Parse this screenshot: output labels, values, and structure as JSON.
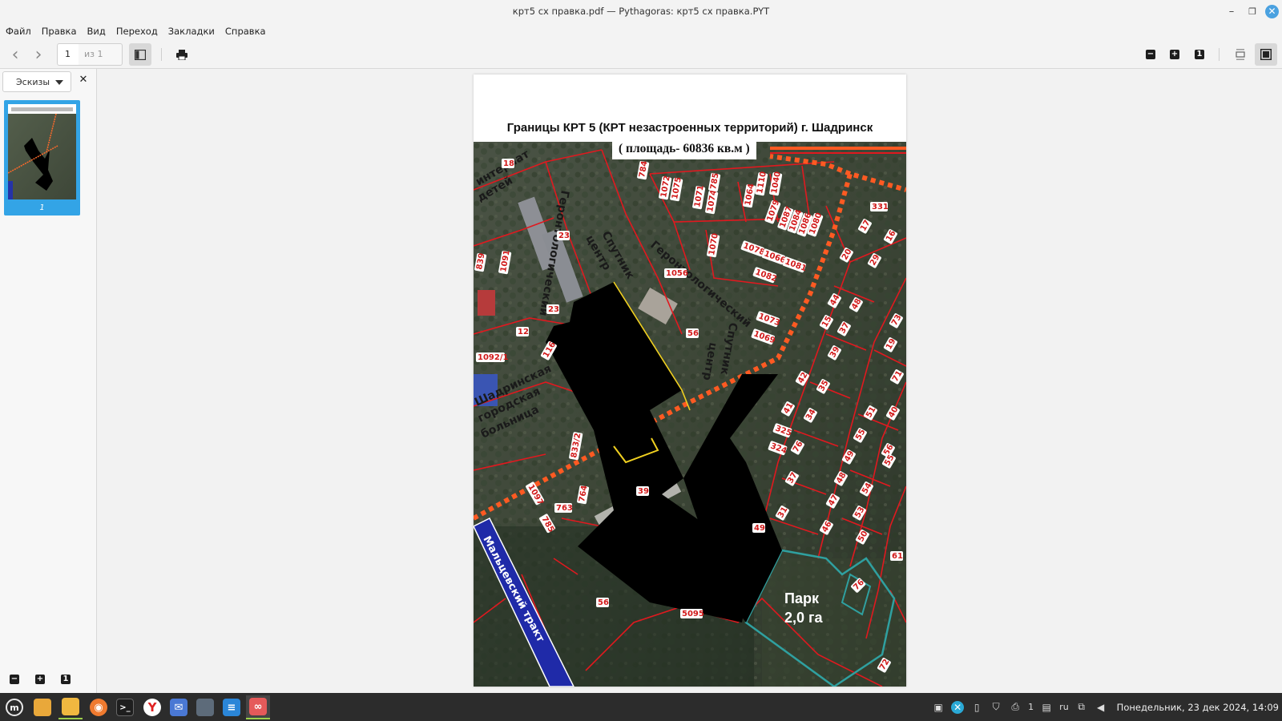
{
  "window": {
    "title": "крт5 сх правка.pdf — Pythagoras: крт5 сх правка.PYT",
    "minimize_glyph": "–",
    "maximize_glyph": "❐",
    "close_glyph": "✕"
  },
  "menu": {
    "items": [
      "Файл",
      "Правка",
      "Вид",
      "Переход",
      "Закладки",
      "Справка"
    ]
  },
  "toolbar": {
    "back_glyph": "‹",
    "forward_glyph": "›",
    "page_current": "1",
    "page_total": "из 1",
    "zoom_out_glyph": "−",
    "zoom_in_glyph": "+",
    "zoom_reset_glyph": "1"
  },
  "sidebar": {
    "view_mode": "Эскизы",
    "close_glyph": "✕",
    "thumbnail_label": "1",
    "zoom_out_glyph": "−",
    "zoom_in_glyph": "+",
    "zoom_reset_glyph": "1"
  },
  "document": {
    "title": "Границы КРТ 5 (КРТ незастроенных территорий) г. Шадринск",
    "area_label": "( площадь- 60836 кв.м )",
    "park_label_line1": "Парк",
    "park_label_line2": "2,0 га",
    "road_label": "Мальцевский тракт",
    "building_labels": {
      "internat_line1": "интернат",
      "internat_line2": "детей",
      "gerontology_1": "Геронтологический",
      "gerontology_1b": "центр",
      "gerontology_1c": "Спутник",
      "gerontology_2": "Геронтологический",
      "gerontology_2b": "центр",
      "gerontology_2c": "Спутник",
      "hospital_line1": "Шадринская",
      "hospital_line2": "городская",
      "hospital_line3": "больница"
    },
    "parcel_numbers": [
      "18",
      "784",
      "1072",
      "1075",
      "1071",
      "1074",
      "785",
      "1064",
      "1110",
      "1040",
      "1079",
      "1087",
      "1084",
      "1086",
      "1080",
      "331",
      "17",
      "16",
      "23",
      "1070",
      "1078",
      "1066",
      "1081",
      "1056",
      "1082",
      "839",
      "1091",
      "23",
      "1073",
      "1069",
      "12",
      "56",
      "1092/1",
      "116",
      "44",
      "48",
      "15",
      "37",
      "39",
      "42",
      "35",
      "41",
      "34",
      "325",
      "324",
      "76",
      "51",
      "40",
      "55",
      "56",
      "49",
      "833/2",
      "1097",
      "764",
      "39",
      "37",
      "31",
      "763",
      "48",
      "54",
      "47",
      "53",
      "55",
      "46",
      "50",
      "785",
      "61",
      "56",
      "5095",
      "76",
      "72",
      "49",
      "71",
      "73",
      "19",
      "20",
      "29"
    ]
  },
  "taskbar": {
    "apps": [
      "mint-menu",
      "files",
      "file-manager",
      "firefox",
      "terminal",
      "yandex-browser",
      "mail",
      "monitor",
      "text-editor",
      "pdf-viewer"
    ],
    "tray_print_count": "1",
    "keyboard_layout": "ru",
    "clock": "Понедельник, 23 дек 2024, 14:09"
  },
  "colors": {
    "selection_accent": "#33a4e6",
    "parcel_border": "#e0191f",
    "boundary_dots": "#ff5a22",
    "park_border": "#2fa0a0",
    "road_fill": "#1f2aa8"
  }
}
